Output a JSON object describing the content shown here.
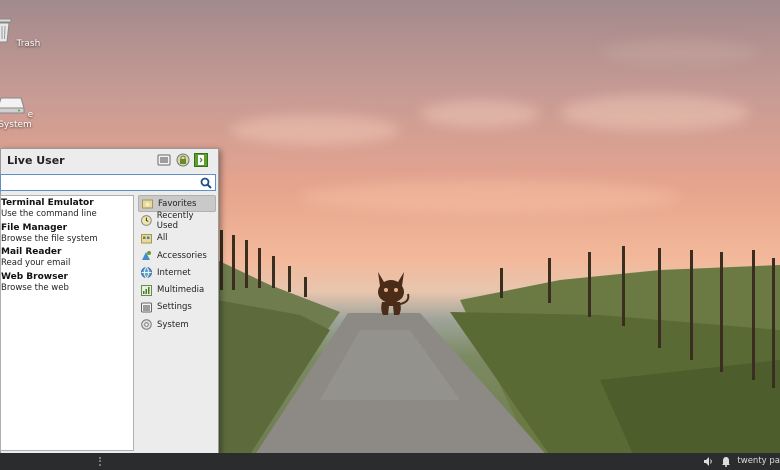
{
  "desktop": {
    "icons": [
      {
        "label": "Trash",
        "icon": "trash-icon"
      },
      {
        "label": "e System",
        "icon": "drive-icon"
      }
    ],
    "mascot_icon": "devil-mascot-icon"
  },
  "menu": {
    "user_name": "Live User",
    "header_buttons": [
      "settings-icon",
      "lock-icon",
      "logout-icon"
    ],
    "search": {
      "value": "",
      "placeholder": ""
    },
    "apps": [
      {
        "name": "Terminal Emulator",
        "desc": "Use the command line"
      },
      {
        "name": "File Manager",
        "desc": "Browse the file system"
      },
      {
        "name": "Mail Reader",
        "desc": "Read your email"
      },
      {
        "name": "Web Browser",
        "desc": "Browse the web"
      }
    ],
    "categories": [
      {
        "label": "Favorites",
        "icon": "folder-star-icon",
        "active": true
      },
      {
        "label": "Recently Used",
        "icon": "clock-icon"
      },
      {
        "label": "All",
        "icon": "grid-icon"
      },
      {
        "label": "Accessories",
        "icon": "accessories-icon"
      },
      {
        "label": "Internet",
        "icon": "globe-icon"
      },
      {
        "label": "Multimedia",
        "icon": "multimedia-icon"
      },
      {
        "label": "Settings",
        "icon": "settings-icon"
      },
      {
        "label": "System",
        "icon": "system-icon"
      }
    ]
  },
  "panel": {
    "clock": "twenty pa"
  },
  "colors": {
    "panel_bg": "#2b2c2e",
    "menu_bg": "#ececec",
    "search_border": "#5f8fc7",
    "active_category": "#c9c9c9"
  }
}
